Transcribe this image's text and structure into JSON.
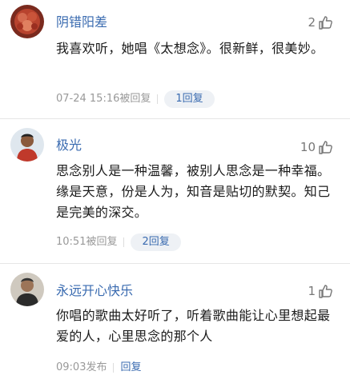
{
  "comments": [
    {
      "username": "阴错阳差",
      "likes": "2",
      "text": "我喜欢听，她唱《太想念》。很新鲜，很美妙。",
      "time": "07-24 15:16",
      "reply_action": "被回复",
      "reply_count": "1回复"
    },
    {
      "username": "极光",
      "likes": "10",
      "text": "思念别人是一种温馨，被别人思念是一种幸福。缘是天意，份是人为，知音是贴切的默契。知己是完美的深交。",
      "time": "10:51",
      "reply_action": "被回复",
      "reply_count": "2回复"
    },
    {
      "username": "永远开心快乐",
      "likes": "1",
      "text": "你唱的歌曲太好听了，听着歌曲能让心里想起最爱的人，心里思念的那个人",
      "time": "09:03",
      "reply_action": "发布",
      "reply_count": "回复"
    }
  ],
  "colors": {
    "username": "#3a6bb0",
    "text": "#1a1a1a",
    "meta": "#999999",
    "pill_bg": "#eef1f5"
  },
  "icons": [
    "thumbs-up-icon"
  ]
}
